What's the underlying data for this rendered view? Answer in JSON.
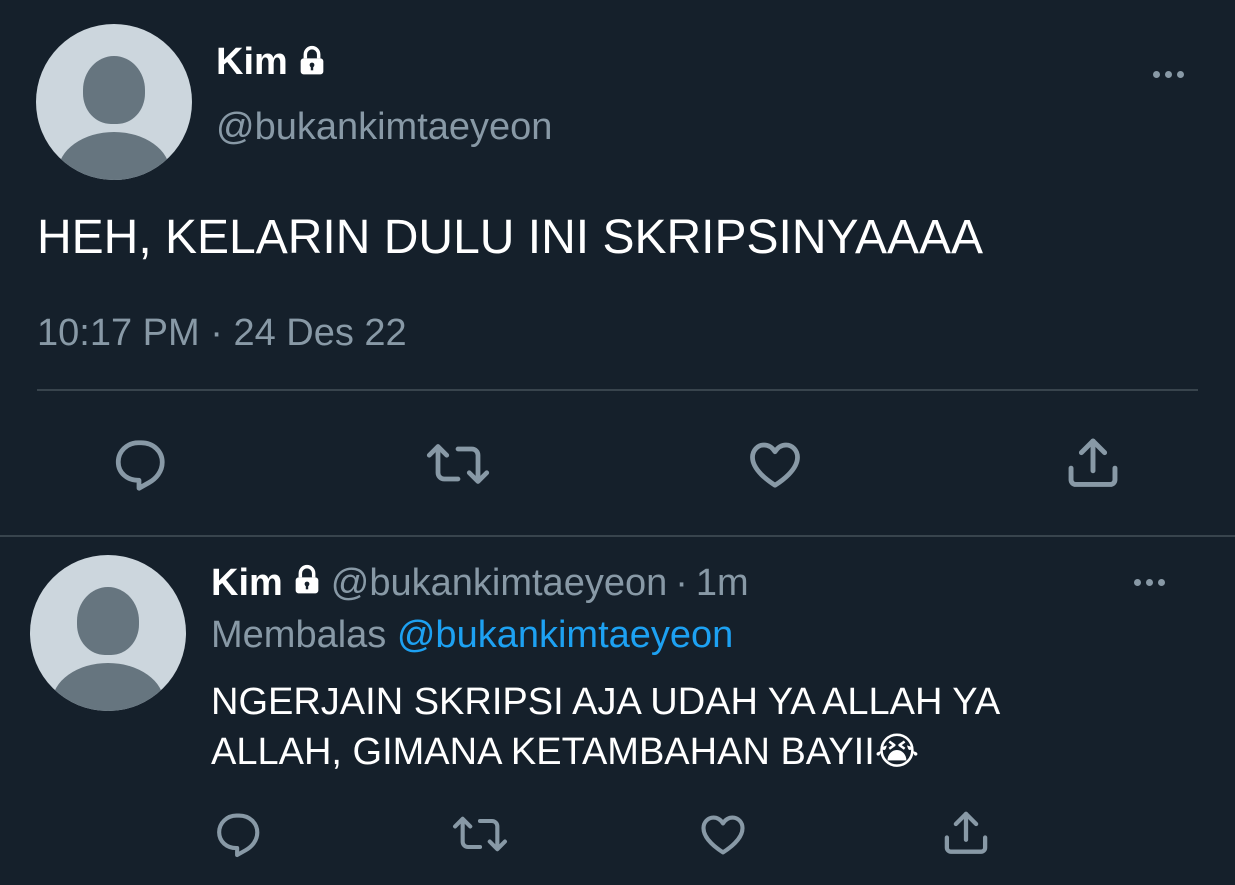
{
  "main_tweet": {
    "display_name": "Kim",
    "handle": "@bukankimtaeyeon",
    "text": "HEH, KELARIN DULU INI SKRIPSINYAAAA",
    "time": "10:17 PM",
    "separator": "·",
    "date": "24 Des 22",
    "icons": [
      "lock-icon",
      "more-icon",
      "reply-icon",
      "retweet-icon",
      "like-icon",
      "share-icon"
    ]
  },
  "reply_tweet": {
    "display_name": "Kim",
    "handle": "@bukankimtaeyeon",
    "separator": "·",
    "age": "1m",
    "replying_label": "Membalas",
    "replying_to": "@bukankimtaeyeon",
    "text_line1": "NGERJAIN SKRIPSI AJA UDAH YA ALLAH YA",
    "text_line2": "ALLAH, GIMANA KETAMBAHAN BAYII",
    "emoji": "😭"
  },
  "colors": {
    "background": "#15202b",
    "text": "#ffffff",
    "muted": "#8899a6",
    "link": "#1da1f2",
    "divider": "#38444d",
    "avatar_bg": "#ccd6dd",
    "avatar_fg": "#66757f"
  }
}
